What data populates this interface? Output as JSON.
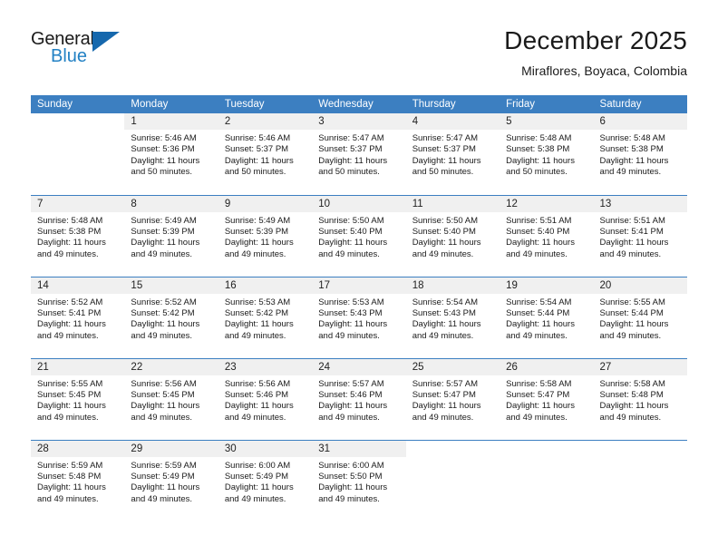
{
  "brand": {
    "name_part1": "General",
    "name_part2": "Blue",
    "accent_color": "#2281c4",
    "triangle_color": "#1668ad"
  },
  "header": {
    "title": "December 2025",
    "subtitle": "Miraflores, Boyaca, Colombia"
  },
  "calendar": {
    "header_bg": "#3c7fc1",
    "daynum_bg": "#f0f0f0",
    "weekday_headers": [
      "Sunday",
      "Monday",
      "Tuesday",
      "Wednesday",
      "Thursday",
      "Friday",
      "Saturday"
    ],
    "weeks": [
      [
        {
          "day": "",
          "blank": true,
          "sunrise": "",
          "sunset": "",
          "daylight_line1": "",
          "daylight_line2": ""
        },
        {
          "day": "1",
          "sunrise": "Sunrise: 5:46 AM",
          "sunset": "Sunset: 5:36 PM",
          "daylight_line1": "Daylight: 11 hours",
          "daylight_line2": "and 50 minutes."
        },
        {
          "day": "2",
          "sunrise": "Sunrise: 5:46 AM",
          "sunset": "Sunset: 5:37 PM",
          "daylight_line1": "Daylight: 11 hours",
          "daylight_line2": "and 50 minutes."
        },
        {
          "day": "3",
          "sunrise": "Sunrise: 5:47 AM",
          "sunset": "Sunset: 5:37 PM",
          "daylight_line1": "Daylight: 11 hours",
          "daylight_line2": "and 50 minutes."
        },
        {
          "day": "4",
          "sunrise": "Sunrise: 5:47 AM",
          "sunset": "Sunset: 5:37 PM",
          "daylight_line1": "Daylight: 11 hours",
          "daylight_line2": "and 50 minutes."
        },
        {
          "day": "5",
          "sunrise": "Sunrise: 5:48 AM",
          "sunset": "Sunset: 5:38 PM",
          "daylight_line1": "Daylight: 11 hours",
          "daylight_line2": "and 50 minutes."
        },
        {
          "day": "6",
          "sunrise": "Sunrise: 5:48 AM",
          "sunset": "Sunset: 5:38 PM",
          "daylight_line1": "Daylight: 11 hours",
          "daylight_line2": "and 49 minutes."
        }
      ],
      [
        {
          "day": "7",
          "sunrise": "Sunrise: 5:48 AM",
          "sunset": "Sunset: 5:38 PM",
          "daylight_line1": "Daylight: 11 hours",
          "daylight_line2": "and 49 minutes."
        },
        {
          "day": "8",
          "sunrise": "Sunrise: 5:49 AM",
          "sunset": "Sunset: 5:39 PM",
          "daylight_line1": "Daylight: 11 hours",
          "daylight_line2": "and 49 minutes."
        },
        {
          "day": "9",
          "sunrise": "Sunrise: 5:49 AM",
          "sunset": "Sunset: 5:39 PM",
          "daylight_line1": "Daylight: 11 hours",
          "daylight_line2": "and 49 minutes."
        },
        {
          "day": "10",
          "sunrise": "Sunrise: 5:50 AM",
          "sunset": "Sunset: 5:40 PM",
          "daylight_line1": "Daylight: 11 hours",
          "daylight_line2": "and 49 minutes."
        },
        {
          "day": "11",
          "sunrise": "Sunrise: 5:50 AM",
          "sunset": "Sunset: 5:40 PM",
          "daylight_line1": "Daylight: 11 hours",
          "daylight_line2": "and 49 minutes."
        },
        {
          "day": "12",
          "sunrise": "Sunrise: 5:51 AM",
          "sunset": "Sunset: 5:40 PM",
          "daylight_line1": "Daylight: 11 hours",
          "daylight_line2": "and 49 minutes."
        },
        {
          "day": "13",
          "sunrise": "Sunrise: 5:51 AM",
          "sunset": "Sunset: 5:41 PM",
          "daylight_line1": "Daylight: 11 hours",
          "daylight_line2": "and 49 minutes."
        }
      ],
      [
        {
          "day": "14",
          "sunrise": "Sunrise: 5:52 AM",
          "sunset": "Sunset: 5:41 PM",
          "daylight_line1": "Daylight: 11 hours",
          "daylight_line2": "and 49 minutes."
        },
        {
          "day": "15",
          "sunrise": "Sunrise: 5:52 AM",
          "sunset": "Sunset: 5:42 PM",
          "daylight_line1": "Daylight: 11 hours",
          "daylight_line2": "and 49 minutes."
        },
        {
          "day": "16",
          "sunrise": "Sunrise: 5:53 AM",
          "sunset": "Sunset: 5:42 PM",
          "daylight_line1": "Daylight: 11 hours",
          "daylight_line2": "and 49 minutes."
        },
        {
          "day": "17",
          "sunrise": "Sunrise: 5:53 AM",
          "sunset": "Sunset: 5:43 PM",
          "daylight_line1": "Daylight: 11 hours",
          "daylight_line2": "and 49 minutes."
        },
        {
          "day": "18",
          "sunrise": "Sunrise: 5:54 AM",
          "sunset": "Sunset: 5:43 PM",
          "daylight_line1": "Daylight: 11 hours",
          "daylight_line2": "and 49 minutes."
        },
        {
          "day": "19",
          "sunrise": "Sunrise: 5:54 AM",
          "sunset": "Sunset: 5:44 PM",
          "daylight_line1": "Daylight: 11 hours",
          "daylight_line2": "and 49 minutes."
        },
        {
          "day": "20",
          "sunrise": "Sunrise: 5:55 AM",
          "sunset": "Sunset: 5:44 PM",
          "daylight_line1": "Daylight: 11 hours",
          "daylight_line2": "and 49 minutes."
        }
      ],
      [
        {
          "day": "21",
          "sunrise": "Sunrise: 5:55 AM",
          "sunset": "Sunset: 5:45 PM",
          "daylight_line1": "Daylight: 11 hours",
          "daylight_line2": "and 49 minutes."
        },
        {
          "day": "22",
          "sunrise": "Sunrise: 5:56 AM",
          "sunset": "Sunset: 5:45 PM",
          "daylight_line1": "Daylight: 11 hours",
          "daylight_line2": "and 49 minutes."
        },
        {
          "day": "23",
          "sunrise": "Sunrise: 5:56 AM",
          "sunset": "Sunset: 5:46 PM",
          "daylight_line1": "Daylight: 11 hours",
          "daylight_line2": "and 49 minutes."
        },
        {
          "day": "24",
          "sunrise": "Sunrise: 5:57 AM",
          "sunset": "Sunset: 5:46 PM",
          "daylight_line1": "Daylight: 11 hours",
          "daylight_line2": "and 49 minutes."
        },
        {
          "day": "25",
          "sunrise": "Sunrise: 5:57 AM",
          "sunset": "Sunset: 5:47 PM",
          "daylight_line1": "Daylight: 11 hours",
          "daylight_line2": "and 49 minutes."
        },
        {
          "day": "26",
          "sunrise": "Sunrise: 5:58 AM",
          "sunset": "Sunset: 5:47 PM",
          "daylight_line1": "Daylight: 11 hours",
          "daylight_line2": "and 49 minutes."
        },
        {
          "day": "27",
          "sunrise": "Sunrise: 5:58 AM",
          "sunset": "Sunset: 5:48 PM",
          "daylight_line1": "Daylight: 11 hours",
          "daylight_line2": "and 49 minutes."
        }
      ],
      [
        {
          "day": "28",
          "sunrise": "Sunrise: 5:59 AM",
          "sunset": "Sunset: 5:48 PM",
          "daylight_line1": "Daylight: 11 hours",
          "daylight_line2": "and 49 minutes."
        },
        {
          "day": "29",
          "sunrise": "Sunrise: 5:59 AM",
          "sunset": "Sunset: 5:49 PM",
          "daylight_line1": "Daylight: 11 hours",
          "daylight_line2": "and 49 minutes."
        },
        {
          "day": "30",
          "sunrise": "Sunrise: 6:00 AM",
          "sunset": "Sunset: 5:49 PM",
          "daylight_line1": "Daylight: 11 hours",
          "daylight_line2": "and 49 minutes."
        },
        {
          "day": "31",
          "sunrise": "Sunrise: 6:00 AM",
          "sunset": "Sunset: 5:50 PM",
          "daylight_line1": "Daylight: 11 hours",
          "daylight_line2": "and 49 minutes."
        },
        {
          "day": "",
          "blank": true,
          "sunrise": "",
          "sunset": "",
          "daylight_line1": "",
          "daylight_line2": ""
        },
        {
          "day": "",
          "blank": true,
          "sunrise": "",
          "sunset": "",
          "daylight_line1": "",
          "daylight_line2": ""
        },
        {
          "day": "",
          "blank": true,
          "sunrise": "",
          "sunset": "",
          "daylight_line1": "",
          "daylight_line2": ""
        }
      ]
    ]
  }
}
